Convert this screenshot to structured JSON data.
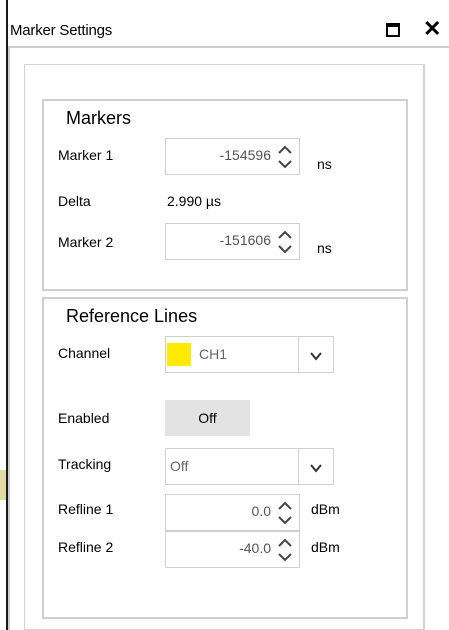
{
  "window": {
    "title": "Marker Settings"
  },
  "markers": {
    "title": "Markers",
    "marker1": {
      "label": "Marker 1",
      "value": "-154596",
      "unit": "ns"
    },
    "delta": {
      "label": "Delta",
      "value": "2.990 µs"
    },
    "marker2": {
      "label": "Marker 2",
      "value": "-151606",
      "unit": "ns"
    }
  },
  "reference_lines": {
    "title": "Reference Lines",
    "channel": {
      "label": "Channel",
      "value": "CH1",
      "color": "#ffeb00"
    },
    "enabled": {
      "label": "Enabled",
      "value": "Off"
    },
    "tracking": {
      "label": "Tracking",
      "value": "Off"
    },
    "refline1": {
      "label": "Refline 1",
      "value": "0.0",
      "unit": "dBm"
    },
    "refline2": {
      "label": "Refline 2",
      "value": "-40.0",
      "unit": "dBm"
    }
  }
}
